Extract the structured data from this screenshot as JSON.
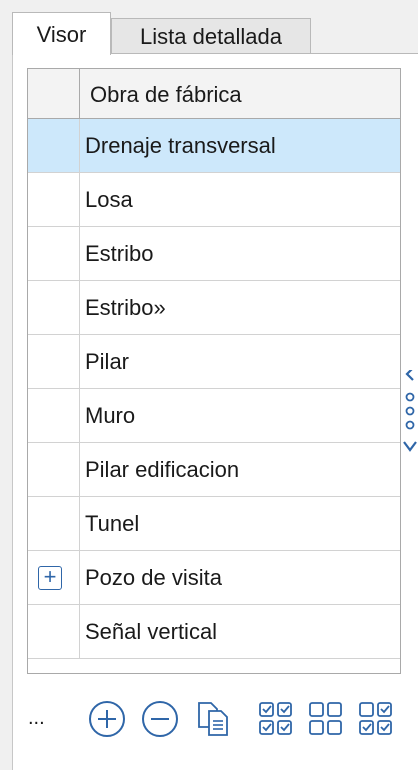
{
  "tabs": {
    "visor": "Visor",
    "lista": "Lista detallada"
  },
  "grid": {
    "column_header": "Obra de fábrica",
    "rows": [
      "Drenaje transversal",
      "Losa",
      "Estribo",
      "Estribo»",
      "Pilar",
      "Muro",
      "Pilar edificacion",
      "Tunel",
      "Pozo de visita",
      "Señal vertical"
    ]
  },
  "toolbar": {
    "more": "..."
  },
  "colors": {
    "accent": "#2f66a8",
    "selection": "#cde8fb"
  },
  "icons": [
    "expand-plus-icon",
    "add-circle-icon",
    "remove-circle-icon",
    "copy-document-icon",
    "check-all-icon",
    "uncheck-all-icon",
    "toggle-check-icon",
    "side-collapse-icon"
  ]
}
